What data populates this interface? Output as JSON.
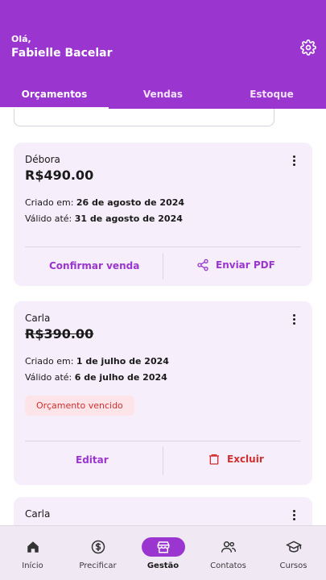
{
  "header": {
    "greeting": "Olá,",
    "user_name": "Fabielle Bacelar",
    "settings_icon": "gear-icon"
  },
  "tabs": [
    {
      "label": "Orçamentos",
      "active": true
    },
    {
      "label": "Vendas",
      "active": false
    },
    {
      "label": "Estoque",
      "active": false
    }
  ],
  "quotes": [
    {
      "client": "Débora",
      "price": "R$490.00",
      "created_label": "Criado em:",
      "created_value": "26 de agosto de 2024",
      "valid_label": "Válido até:",
      "valid_value": "31 de agosto de 2024",
      "action_left": "Confirmar venda",
      "action_right": "Enviar PDF"
    },
    {
      "client": "Carla",
      "price": "R$390.00",
      "created_label": "Criado em:",
      "created_value": "1 de julho de 2024",
      "valid_label": "Válido até:",
      "valid_value": "6 de julho de 2024",
      "status_badge": "Orçamento vencido",
      "action_left": "Editar",
      "action_right": "Excluir"
    },
    {
      "client": "Carla"
    }
  ],
  "bottom_nav": [
    {
      "label": "Início",
      "icon": "home-icon",
      "active": false
    },
    {
      "label": "Precificar",
      "icon": "dollar-circle-icon",
      "active": false
    },
    {
      "label": "Gestão",
      "icon": "store-icon",
      "active": true
    },
    {
      "label": "Contatos",
      "icon": "people-icon",
      "active": false
    },
    {
      "label": "Cursos",
      "icon": "graduation-cap-icon",
      "active": false
    }
  ],
  "colors": {
    "primary": "#9b35cf",
    "danger": "#d32f2f",
    "card_bg": "#f6eefa"
  }
}
